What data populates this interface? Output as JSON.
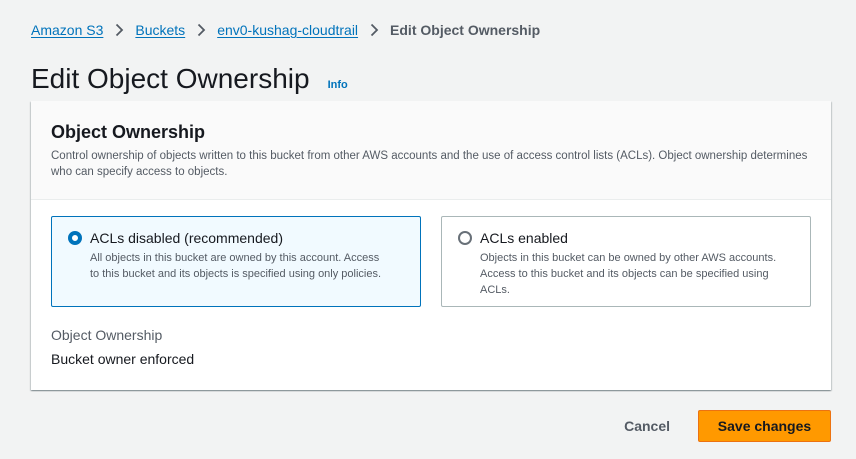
{
  "breadcrumb": {
    "items": [
      "Amazon S3",
      "Buckets",
      "env0-kushag-cloudtrail"
    ],
    "current": "Edit Object Ownership"
  },
  "page": {
    "title": "Edit Object Ownership",
    "info_label": "Info"
  },
  "panel": {
    "title": "Object Ownership",
    "description": "Control ownership of objects written to this bucket from other AWS accounts and the use of access control lists (ACLs). Object ownership determines who can specify access to objects.",
    "options": [
      {
        "label": "ACLs disabled (recommended)",
        "description": "All objects in this bucket are owned by this account. Access to this bucket and its objects is specified using only policies.",
        "selected": true
      },
      {
        "label": "ACLs enabled",
        "description": "Objects in this bucket can be owned by other AWS accounts. Access to this bucket and its objects can be specified using ACLs.",
        "selected": false
      }
    ],
    "ownership_label": "Object Ownership",
    "ownership_value": "Bucket owner enforced"
  },
  "actions": {
    "cancel_label": "Cancel",
    "save_label": "Save changes"
  },
  "colors": {
    "link": "#0073bb",
    "primary_button": "#ff9900",
    "selected_tile_bg": "#f1faff",
    "page_bg": "#f2f3f3"
  },
  "icons": {
    "separator": "chevron-right-icon",
    "radio": "radio-icon"
  }
}
